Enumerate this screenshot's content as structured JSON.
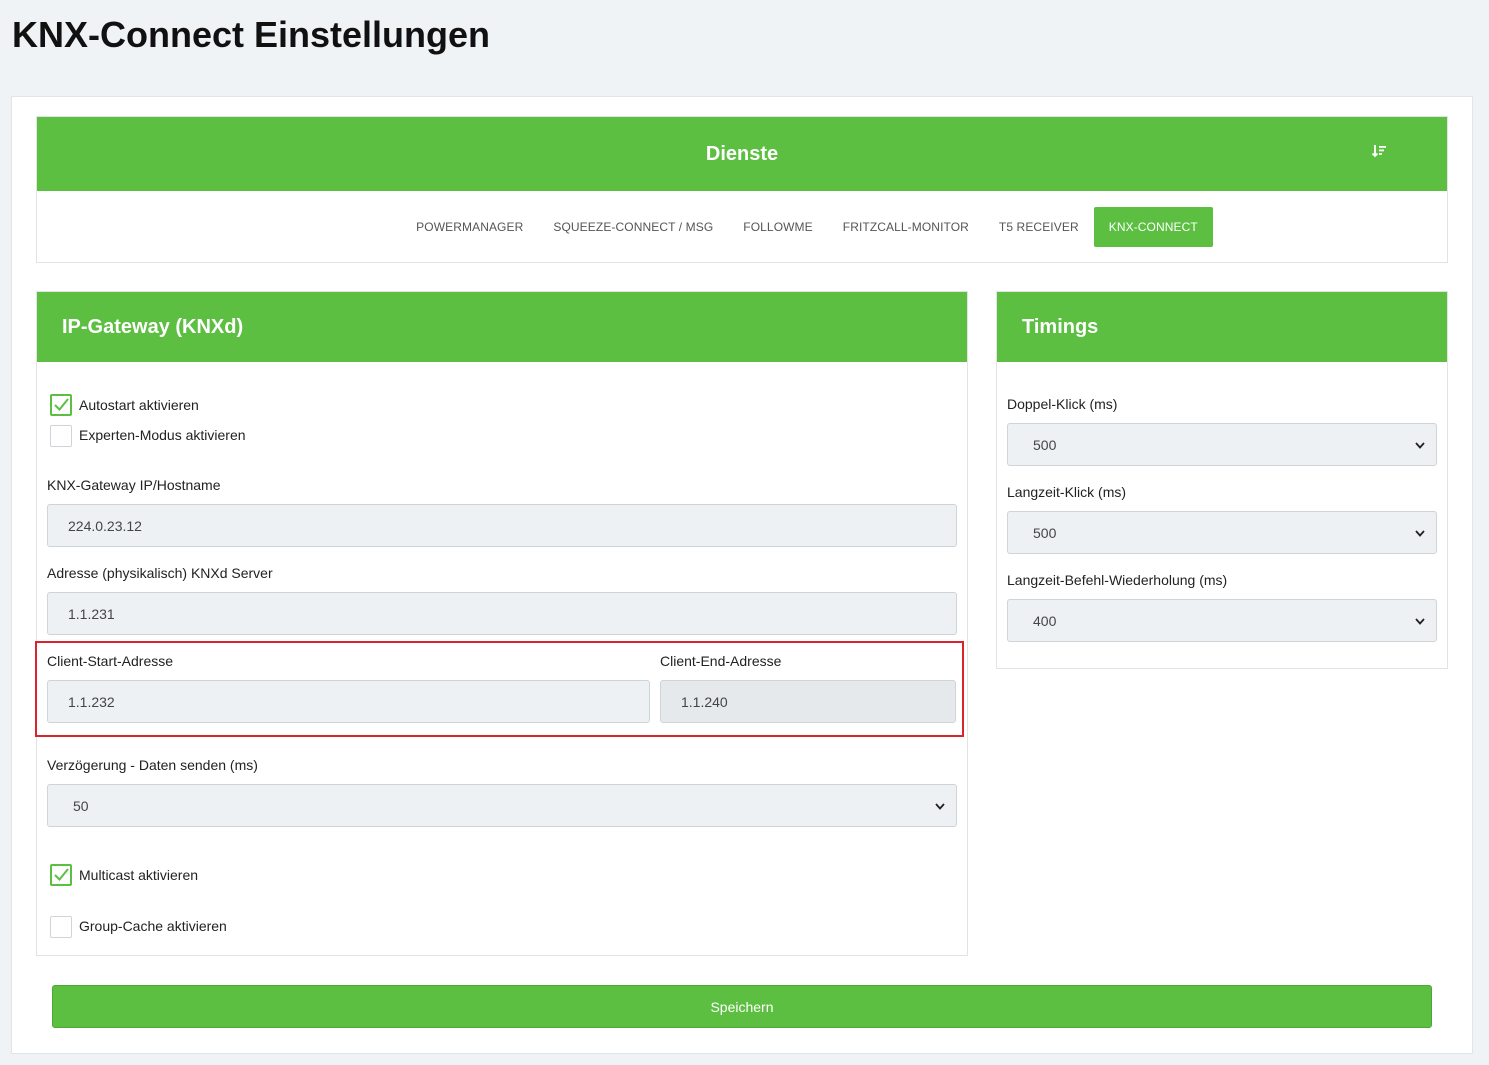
{
  "page": {
    "title": "KNX-Connect Einstellungen"
  },
  "services": {
    "title": "Dienste",
    "sort_icon": "sort-descending-icon",
    "tabs": [
      {
        "label": "POWERMANAGER"
      },
      {
        "label": "SQUEEZE-CONNECT / MSG"
      },
      {
        "label": "FOLLOWME"
      },
      {
        "label": "FRITZCALL-MONITOR"
      },
      {
        "label": "T5 RECEIVER"
      },
      {
        "label": "KNX-CONNECT",
        "active": true
      }
    ]
  },
  "gateway": {
    "title": "IP-Gateway (KNXd)",
    "autostart": {
      "label": "Autostart aktivieren",
      "checked": true
    },
    "expert_mode": {
      "label": "Experten-Modus aktivieren",
      "checked": false
    },
    "host": {
      "label": "KNX-Gateway IP/Hostname",
      "value": "224.0.23.12"
    },
    "physical_address": {
      "label": "Adresse (physikalisch) KNXd Server",
      "value": "1.1.231"
    },
    "client_start": {
      "label": "Client-Start-Adresse",
      "value": "1.1.232"
    },
    "client_end": {
      "label": "Client-End-Adresse",
      "value": "1.1.240"
    },
    "delay": {
      "label": "Verzögerung - Daten senden (ms)",
      "value": "50"
    },
    "multicast": {
      "label": "Multicast aktivieren",
      "checked": true
    },
    "group_cache": {
      "label": "Group-Cache aktivieren",
      "checked": false
    }
  },
  "timings": {
    "title": "Timings",
    "double_click": {
      "label": "Doppel-Klick (ms)",
      "value": "500"
    },
    "long_click": {
      "label": "Langzeit-Klick (ms)",
      "value": "500"
    },
    "repeat": {
      "label": "Langzeit-Befehl-Wiederholung (ms)",
      "value": "400"
    }
  },
  "save_label": "Speichern",
  "colors": {
    "accent": "#5cbf42",
    "highlight": "#d9232d"
  }
}
